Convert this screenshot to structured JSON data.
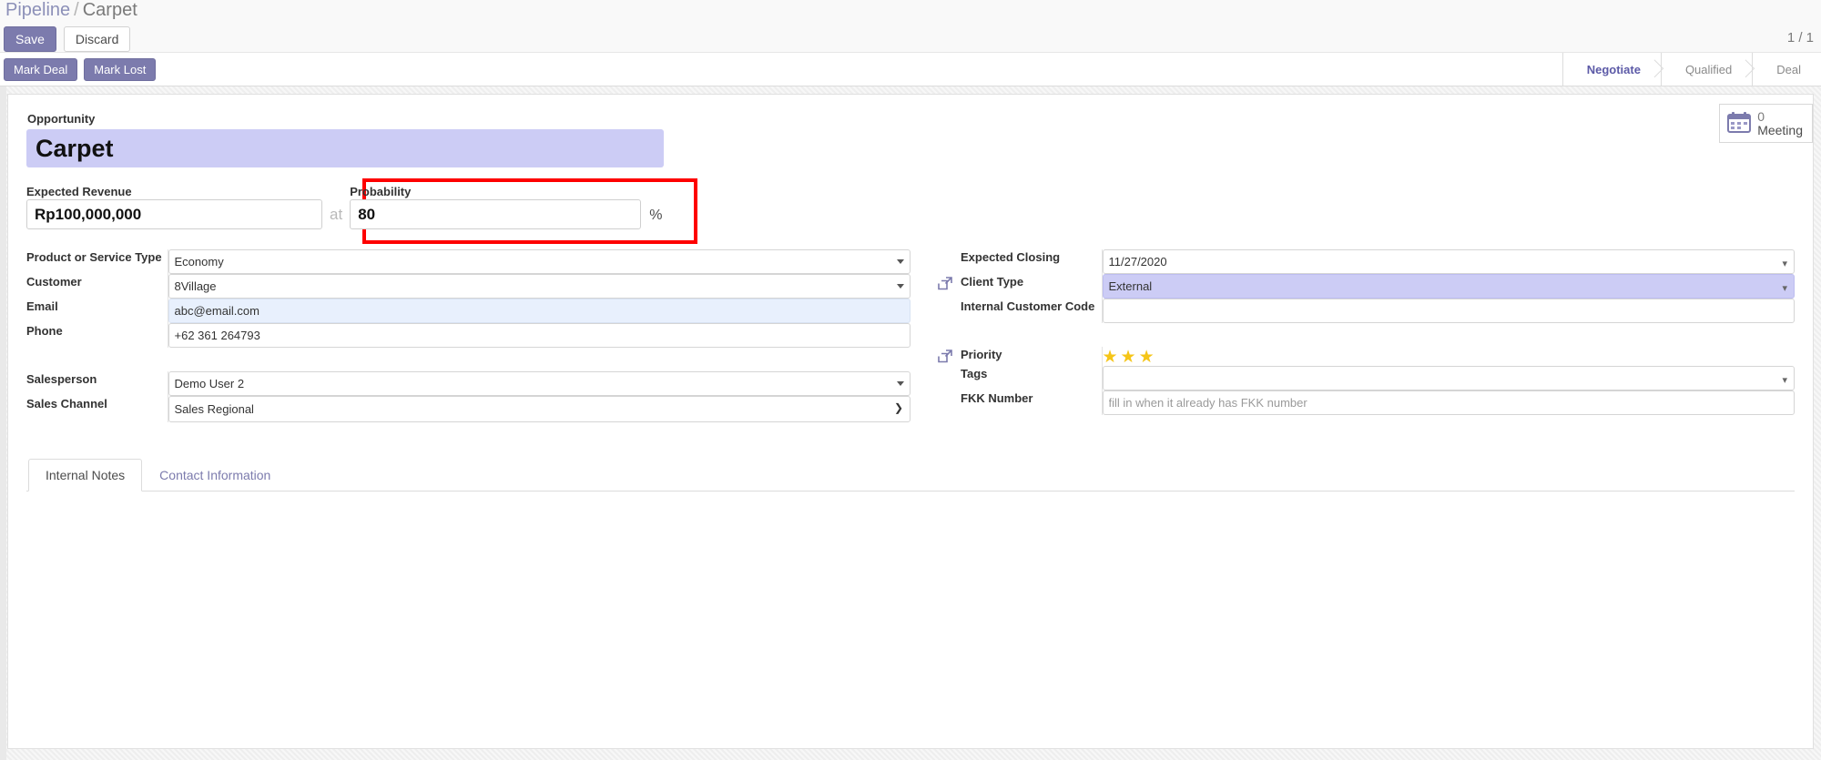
{
  "breadcrumb": {
    "root": "Pipeline",
    "separator": "/",
    "current": "Carpet"
  },
  "toolbar": {
    "save_label": "Save",
    "discard_label": "Discard",
    "pager": "1 / 1"
  },
  "action_bar": {
    "mark_deal_label": "Mark Deal",
    "mark_lost_label": "Mark Lost",
    "statusbar": [
      {
        "label": "Negotiate",
        "active": true
      },
      {
        "label": "Qualified",
        "active": false
      },
      {
        "label": "Deal",
        "active": false
      }
    ]
  },
  "stat_button": {
    "icon": "calendar-icon",
    "value": "0",
    "label": "Meeting"
  },
  "opportunity": {
    "label": "Opportunity",
    "value": "Carpet"
  },
  "expected_revenue": {
    "label": "Expected Revenue",
    "value": "Rp100,000,000",
    "joiner": "at"
  },
  "probability": {
    "label": "Probability",
    "value": "80",
    "suffix": "%",
    "highlight_color": "#fe0000"
  },
  "left_fields": [
    {
      "label": "Product or Service Type",
      "value": "Economy",
      "widget": "select-triangle",
      "placeholder": ""
    },
    {
      "label": "Customer",
      "value": "8Village",
      "widget": "select-triangle",
      "placeholder": ""
    },
    {
      "label": "Email",
      "value": "abc@email.com",
      "widget": "text-email",
      "placeholder": ""
    },
    {
      "label": "Phone",
      "value": "+62 361 264793",
      "widget": "text",
      "placeholder": ""
    }
  ],
  "left_fields_2": [
    {
      "label": "Salesperson",
      "value": "Demo User 2",
      "widget": "select-triangle",
      "placeholder": ""
    },
    {
      "label": "Sales Channel",
      "value": "Sales Regional",
      "widget": "select-chevron",
      "placeholder": ""
    }
  ],
  "right_fields": [
    {
      "label": "Expected Closing",
      "value": "11/27/2020",
      "widget": "select-small",
      "icon": "",
      "placeholder": ""
    },
    {
      "label": "Client Type",
      "value": "External",
      "widget": "select-small-highlight",
      "icon": "external-link-icon",
      "placeholder": ""
    },
    {
      "label": "Internal Customer Code",
      "value": "",
      "widget": "text",
      "icon": "",
      "placeholder": ""
    }
  ],
  "right_fields_2": [
    {
      "label": "Priority",
      "value": "",
      "widget": "stars",
      "icon": "external-link-icon",
      "stars_filled": 3,
      "placeholder": ""
    },
    {
      "label": "Tags",
      "value": "",
      "widget": "select-small",
      "icon": "",
      "placeholder": ""
    },
    {
      "label": "FKK Number",
      "value": "",
      "widget": "text",
      "icon": "",
      "placeholder": "fill in when it already has FKK number"
    }
  ],
  "notebook": {
    "tabs": [
      {
        "label": "Internal Notes",
        "active": true
      },
      {
        "label": "Contact Information",
        "active": false
      }
    ],
    "body_text": ""
  },
  "colors": {
    "primary": "#7c7bad",
    "highlight": "#ccccf5",
    "email_bg": "#e8f0fd",
    "star": "#f5c518",
    "annotation": "#fe0000"
  }
}
